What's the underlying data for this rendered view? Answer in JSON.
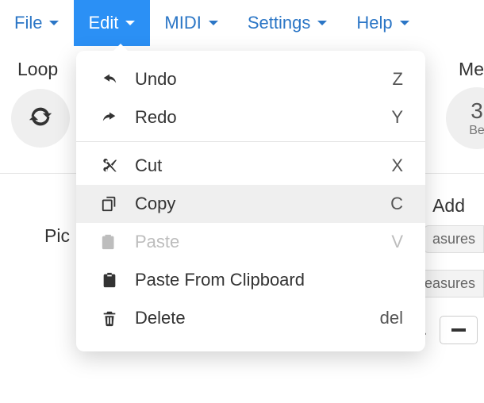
{
  "menubar": {
    "items": [
      {
        "label": "File"
      },
      {
        "label": "Edit"
      },
      {
        "label": "MIDI"
      },
      {
        "label": "Settings"
      },
      {
        "label": "Help"
      }
    ],
    "active_index": 1
  },
  "edit_menu": {
    "groups": [
      [
        {
          "icon": "undo-icon",
          "label": "Undo",
          "shortcut": "Z",
          "disabled": false
        },
        {
          "icon": "redo-icon",
          "label": "Redo",
          "shortcut": "Y",
          "disabled": false
        }
      ],
      [
        {
          "icon": "scissors-icon",
          "label": "Cut",
          "shortcut": "X",
          "disabled": false
        },
        {
          "icon": "copy-icon",
          "label": "Copy",
          "shortcut": "C",
          "disabled": false,
          "hover": true
        },
        {
          "icon": "paste-icon",
          "label": "Paste",
          "shortcut": "V",
          "disabled": true
        },
        {
          "icon": "clipboard-icon",
          "label": "Paste From Clipboard",
          "shortcut": "",
          "disabled": false
        },
        {
          "icon": "trash-icon",
          "label": "Delete",
          "shortcut": "del",
          "disabled": false
        }
      ]
    ]
  },
  "background": {
    "loop_label": "Loop",
    "pic_fragment": "Pic",
    "right_header_fragment": "Me",
    "right_circle_main": "3",
    "right_circle_sub": "Be",
    "add_label": "Add",
    "pill1": "asures",
    "pill2": "easures"
  }
}
